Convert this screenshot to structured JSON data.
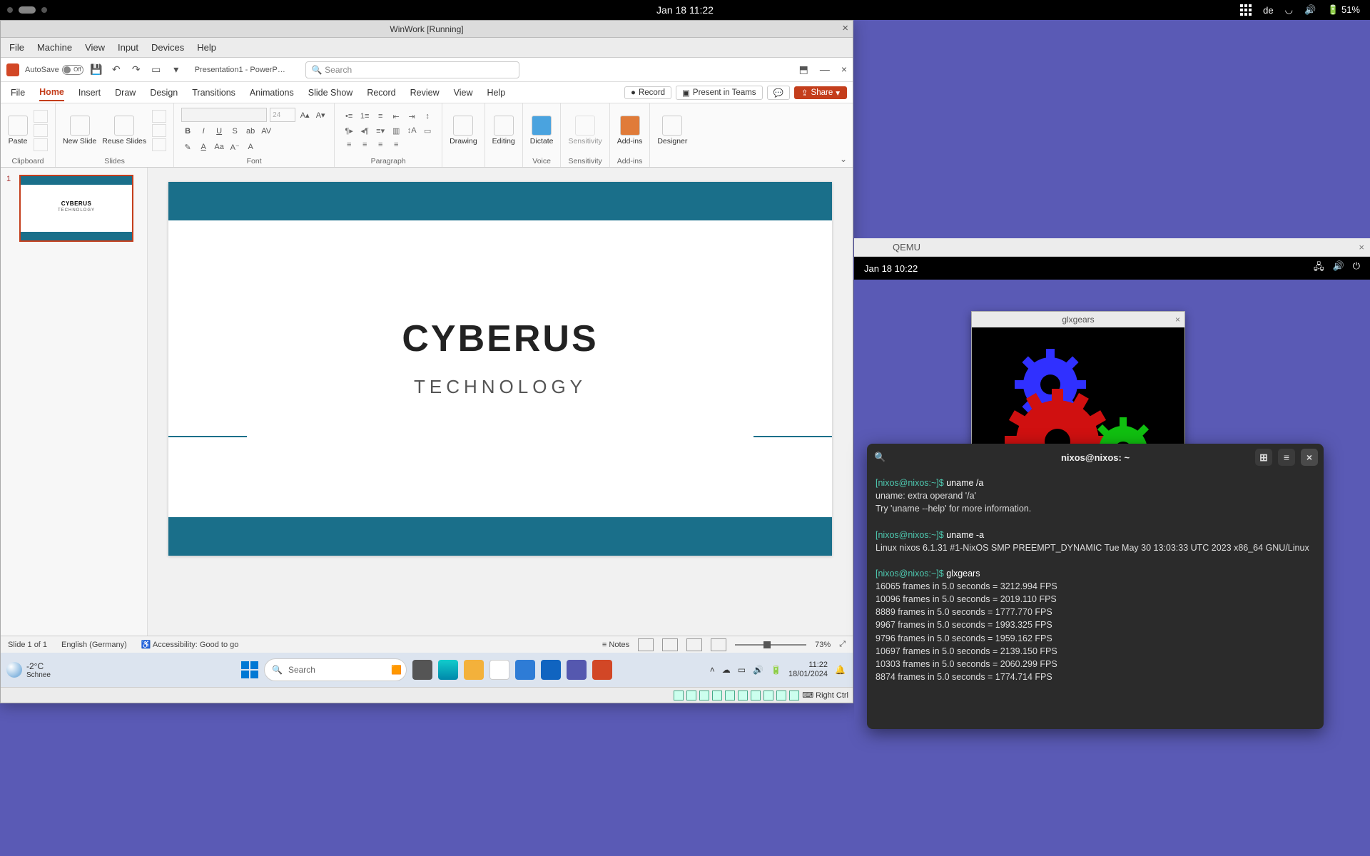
{
  "gnome": {
    "clock": "Jan 18  11:22",
    "lang": "de",
    "battery": "51%"
  },
  "vbox": {
    "title": "WinWork [Running]",
    "menu": [
      "File",
      "Machine",
      "View",
      "Input",
      "Devices",
      "Help"
    ],
    "hostkey": "Right Ctrl"
  },
  "powerpoint": {
    "autosave_label": "AutoSave",
    "autosave_state": "Off",
    "doc_title": "Presentation1 - PowerP…",
    "search_placeholder": "Search",
    "tabs": [
      "File",
      "Home",
      "Insert",
      "Draw",
      "Design",
      "Transitions",
      "Animations",
      "Slide Show",
      "Record",
      "Review",
      "View",
      "Help"
    ],
    "active_tab": "Home",
    "header_buttons": {
      "record": "Record",
      "teams": "Present in Teams",
      "share": "Share"
    },
    "ribbon": {
      "paste": "Paste",
      "new_slide": "New Slide",
      "reuse_slides": "Reuse Slides",
      "font_size_hint": "24",
      "drawing": "Drawing",
      "editing": "Editing",
      "dictate": "Dictate",
      "sensitivity": "Sensitivity",
      "addins": "Add-ins",
      "designer": "Designer",
      "groups": {
        "clipboard": "Clipboard",
        "slides": "Slides",
        "font": "Font",
        "paragraph": "Paragraph",
        "voice": "Voice",
        "sensitivity": "Sensitivity",
        "addins": "Add-ins"
      }
    },
    "slide": {
      "number": "1",
      "title": "CYBERUS",
      "subtitle": "TECHNOLOGY"
    },
    "status": {
      "slide_of": "Slide 1 of 1",
      "lang": "English (Germany)",
      "access": "Accessibility: Good to go",
      "notes": "Notes",
      "zoom": "73%"
    }
  },
  "windows": {
    "weather_temp": "-2°C",
    "weather_desc": "Schnee",
    "search": "Search",
    "time": "11:22",
    "date": "18/01/2024"
  },
  "qemu": {
    "title": "QEMU",
    "clock": "Jan 18  10:22",
    "glx_title": "glxgears",
    "term_title": "nixos@nixos: ~",
    "prompt": "[nixos@nixos:~]$",
    "lines": [
      {
        "t": "cmd",
        "txt": "uname /a"
      },
      {
        "t": "out",
        "txt": "uname: extra operand '/a'"
      },
      {
        "t": "out",
        "txt": "Try 'uname --help' for more information."
      },
      {
        "t": "blank",
        "txt": ""
      },
      {
        "t": "cmd",
        "txt": "uname -a"
      },
      {
        "t": "out",
        "txt": "Linux nixos 6.1.31 #1-NixOS SMP PREEMPT_DYNAMIC Tue May 30 13:03:33 UTC 2023 x86_64 GNU/Linux"
      },
      {
        "t": "blank",
        "txt": ""
      },
      {
        "t": "cmd",
        "txt": "glxgears"
      },
      {
        "t": "out",
        "txt": "16065 frames in 5.0 seconds = 3212.994 FPS"
      },
      {
        "t": "out",
        "txt": "10096 frames in 5.0 seconds = 2019.110 FPS"
      },
      {
        "t": "out",
        "txt": "8889 frames in 5.0 seconds = 1777.770 FPS"
      },
      {
        "t": "out",
        "txt": "9967 frames in 5.0 seconds = 1993.325 FPS"
      },
      {
        "t": "out",
        "txt": "9796 frames in 5.0 seconds = 1959.162 FPS"
      },
      {
        "t": "out",
        "txt": "10697 frames in 5.0 seconds = 2139.150 FPS"
      },
      {
        "t": "out",
        "txt": "10303 frames in 5.0 seconds = 2060.299 FPS"
      },
      {
        "t": "out",
        "txt": "8874 frames in 5.0 seconds = 1774.714 FPS"
      }
    ]
  }
}
